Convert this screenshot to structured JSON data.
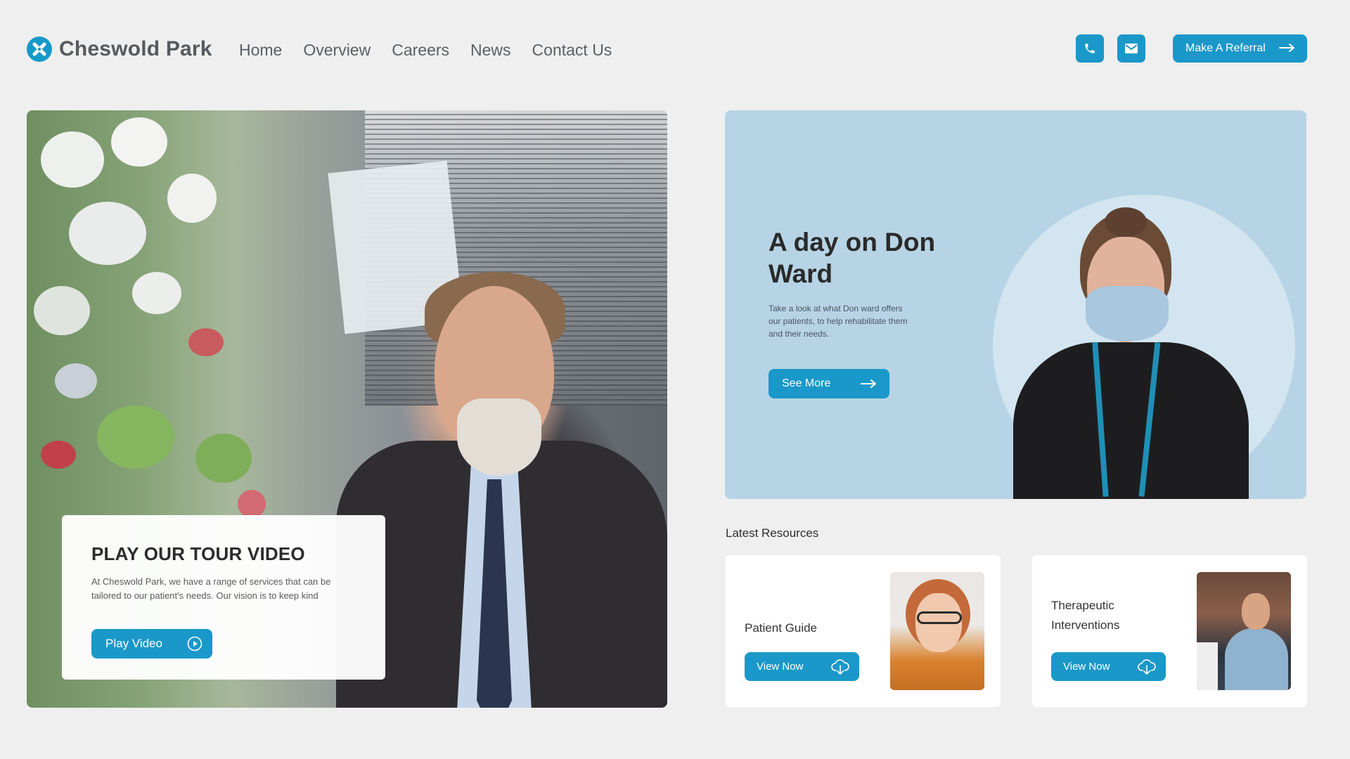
{
  "brand": {
    "name": "Cheswold Park"
  },
  "nav": {
    "items": [
      {
        "label": "Home"
      },
      {
        "label": "Overview"
      },
      {
        "label": "Careers"
      },
      {
        "label": "News"
      },
      {
        "label": "Contact Us"
      }
    ]
  },
  "header_actions": {
    "phone_icon": "phone-icon",
    "mail_icon": "mail-icon",
    "referral_label": "Make A Referral"
  },
  "hero": {
    "title": "PLAY OUR TOUR VIDEO",
    "text": "At Cheswold Park, we have a range of services that can be tailored to our patient's needs. Our vision is to keep kind",
    "button_label": "Play Video"
  },
  "feature": {
    "title": "A day on Don Ward",
    "text": "Take a look at what Don ward offers our patients, to help rehabilitate them and their needs.",
    "button_label": "See More"
  },
  "resources": {
    "heading": "Latest Resources",
    "items": [
      {
        "title": "Patient Guide",
        "button_label": "View Now"
      },
      {
        "title": "Therapeutic Interventions",
        "button_label": "View Now"
      }
    ]
  },
  "colors": {
    "accent": "#1a98c9",
    "page_bg": "#efefef",
    "feature_bg": "#b7d4e6"
  }
}
